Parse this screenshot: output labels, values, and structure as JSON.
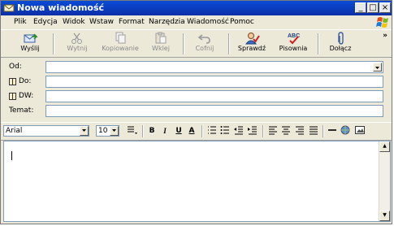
{
  "window": {
    "title": "Nowa wiadomość"
  },
  "menu": [
    "Plik",
    "Edycja",
    "Widok",
    "Wstaw",
    "Format",
    "Narzędzia",
    "Wiadomość",
    "Pomoc"
  ],
  "toolbar": {
    "send": "Wyślij",
    "cut": "Wytnij",
    "copy": "Kopiowanie",
    "paste": "Wklej",
    "undo": "Cofnij",
    "check": "Sprawdź",
    "spelling": "Pisownia",
    "attach": "Dołącz"
  },
  "headers": {
    "from_label": "Od:",
    "to_label": "Do:",
    "cc_label": "DW:",
    "subject_label": "Temat:",
    "from_value": "",
    "to_value": "",
    "cc_value": "",
    "subject_value": ""
  },
  "format": {
    "font": "Arial",
    "size": "10",
    "bold": "B",
    "italic": "I",
    "underline": "U",
    "color": "A"
  },
  "colors": {
    "title_bar": "#0b3fc6",
    "chrome": "#ece9d8",
    "field_border": "#7f9db9"
  },
  "icons": [
    "send-icon",
    "cut-icon",
    "copy-icon",
    "paste-icon",
    "undo-icon",
    "check-names-icon",
    "spelling-icon",
    "attach-icon",
    "address-book-icon"
  ]
}
